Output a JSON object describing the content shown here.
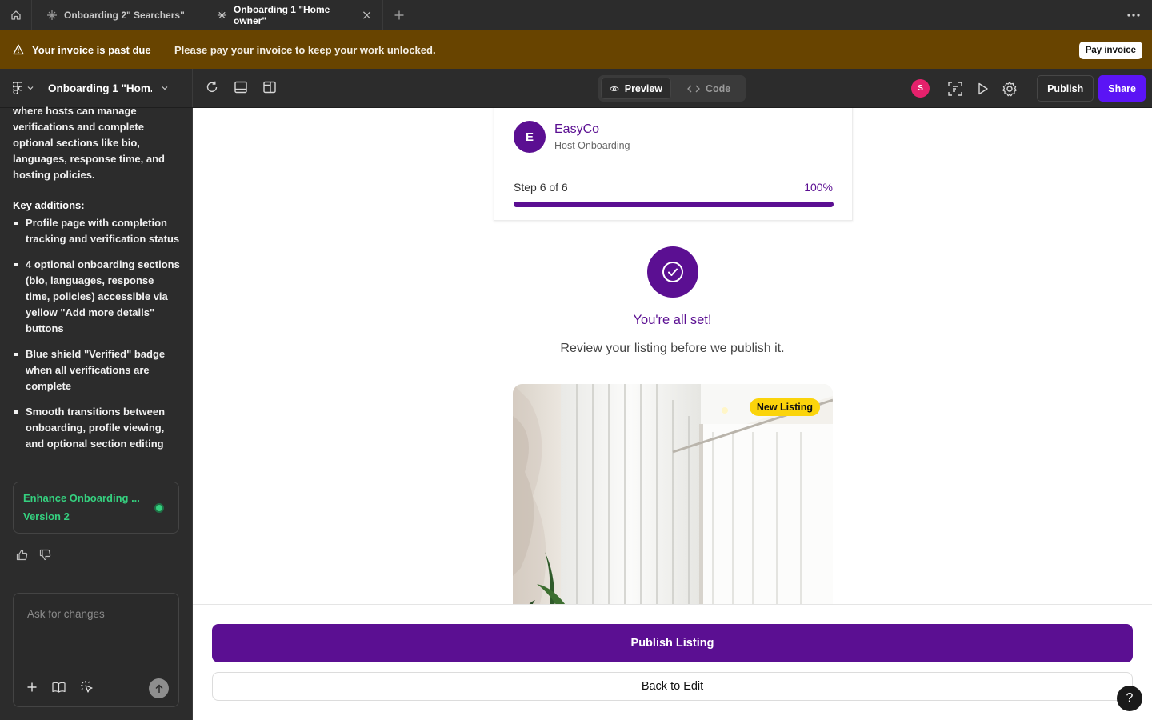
{
  "tabs": [
    {
      "label": "Onboarding 2\" Searchers\"",
      "active": false
    },
    {
      "label": "Onboarding 1 \"Home owner\"",
      "active": true
    }
  ],
  "banner": {
    "title": "Your invoice is past due",
    "message": "Please pay your invoice to keep your work unlocked.",
    "button": "Pay invoice"
  },
  "toolbar": {
    "project_name": "Onboarding 1 \"Hom...",
    "preview_label": "Preview",
    "code_label": "Code",
    "avatar_initial": "S",
    "publish_label": "Publish",
    "share_label": "Share"
  },
  "sidebar": {
    "intro": "where hosts can manage verifications and complete optional sections like bio, languages, response time, and hosting policies.",
    "heading": "Key additions:",
    "items": [
      "Profile page with completion tracking and verification status",
      "4 optional onboarding sections (bio, languages, response time, policies) accessible via yellow \"Add more details\" buttons",
      "Blue shield \"Verified\" badge when all verifications are complete",
      "Smooth transitions between onboarding, profile viewing, and optional section editing"
    ],
    "version_title": "Enhance Onboarding ...",
    "version_sub": "Version 2",
    "chat_placeholder": "Ask for changes"
  },
  "preview": {
    "brand_initial": "E",
    "brand_name": "EasyCo",
    "brand_sub": "Host Onboarding",
    "step_label": "Step 6 of 6",
    "step_percent": "100%",
    "progress": 1.0,
    "success_title": "You're all set!",
    "success_sub": "Review your listing before we publish it.",
    "badge": "New Listing",
    "primary_button": "Publish Listing",
    "secondary_button": "Back to Edit",
    "help": "?"
  },
  "colors": {
    "brand_purple": "#5b0f92",
    "share_blue": "#5b14f5",
    "banner_brown": "#684400",
    "badge_yellow": "#fbd40b",
    "status_green": "#35d07f"
  }
}
